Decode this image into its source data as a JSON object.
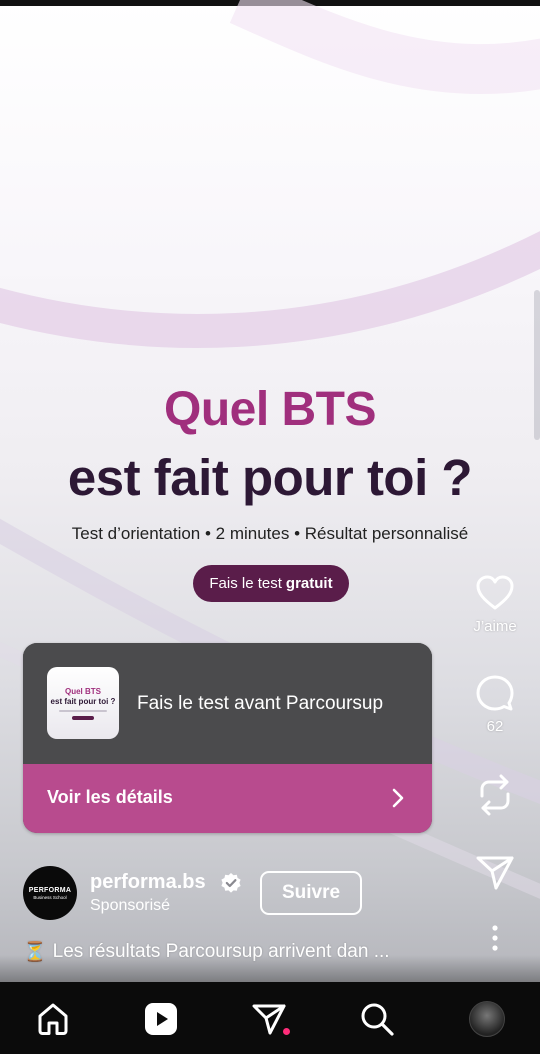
{
  "ad": {
    "headline_line1": "Quel BTS",
    "headline_line2": "est fait pour toi ?",
    "subline": "Test d’orientation • 2 minutes • Résultat personnalisé",
    "cta_prefix": "Fais le test",
    "cta_bold": "gratuit"
  },
  "card": {
    "thumb_line1": "Quel BTS",
    "thumb_line2": "est fait pour toi ?",
    "title": "Fais le test avant Parcoursup",
    "link_label": "Voir les détails"
  },
  "rail": {
    "like_label": "J’aime",
    "comment_count": "62"
  },
  "account": {
    "avatar_line1": "PERFORMA",
    "avatar_line2": "Business School",
    "username": "performa.bs",
    "sponsored_label": "Sponsorisé",
    "follow_label": "Suivre"
  },
  "caption": {
    "emoji": "⏳",
    "text": "Les résultats Parcoursup arrivent dan ..."
  },
  "colors": {
    "headline_accent": "#a02f7d",
    "headline_dark": "#2d1835",
    "cta_bg": "#5a1d4a",
    "card_link_bg": "#b84b8e",
    "nav_bg": "#0b0b0b",
    "notification_dot": "#ff2d7a"
  },
  "icons": {
    "rail": [
      "heart-icon",
      "comment-icon",
      "repost-icon",
      "send-icon",
      "more-vertical-icon"
    ],
    "nav": [
      "home-icon",
      "reels-icon",
      "direct-icon",
      "search-icon",
      "profile-avatar"
    ]
  }
}
